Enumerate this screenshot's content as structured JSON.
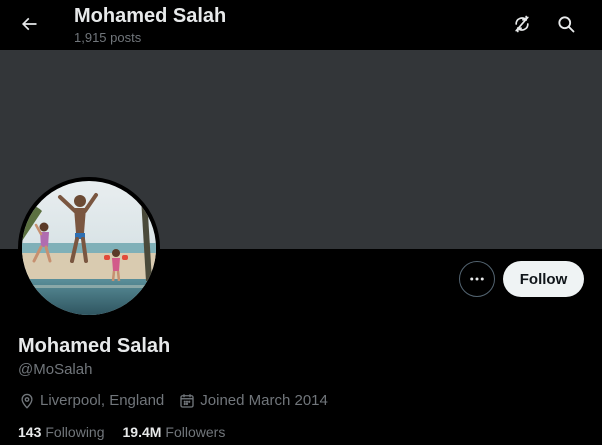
{
  "header": {
    "title": "Mohamed Salah",
    "post_count": "1,915 posts",
    "back_icon": "arrow-left-icon",
    "actions": [
      {
        "icon": "sync-icon"
      },
      {
        "icon": "search-icon"
      }
    ]
  },
  "banner": {
    "color": "#333639"
  },
  "profile": {
    "name": "Mohamed Salah",
    "handle": "@MoSalah",
    "location": "Liverpool, England",
    "joined": "Joined March 2014",
    "following_count": "143",
    "following_label": "Following",
    "followers_count": "19.4M",
    "followers_label": "Followers"
  },
  "actions": {
    "more_icon": "more-horizontal-icon",
    "follow_label": "Follow"
  },
  "colors": {
    "background": "#000000",
    "text_primary": "#e7e9ea",
    "text_secondary": "#71767b",
    "follow_button_bg": "#eff3f4",
    "border": "#536471"
  }
}
